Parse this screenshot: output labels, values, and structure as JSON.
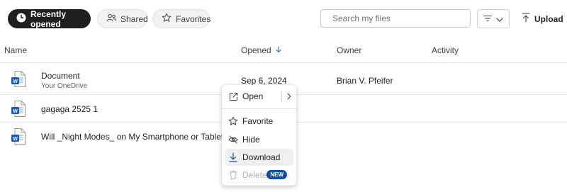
{
  "toolbar": {
    "pills": [
      {
        "label": "Recently opened",
        "icon": "clock-icon"
      },
      {
        "label": "Shared",
        "icon": "people-icon"
      },
      {
        "label": "Favorites",
        "icon": "star-icon"
      }
    ],
    "search_placeholder": "Search my files",
    "filter_icon": "filter-icon",
    "upload_label": "Upload"
  },
  "columns": {
    "name": "Name",
    "opened": "Opened",
    "owner": "Owner",
    "activity": "Activity"
  },
  "files": [
    {
      "name": "Document",
      "location": "Your OneDrive",
      "opened": "Sep 6, 2024",
      "owner": "Brian V. Pfeifer",
      "icon": "word-file-icon"
    },
    {
      "name": "gagaga 2525 1",
      "location": "",
      "opened": "",
      "owner": "",
      "icon": "word-file-icon"
    },
    {
      "name": "Will _Night Modes_ on My Smartphone or Tablet Actua",
      "location": "",
      "opened": "",
      "owner": "",
      "icon": "word-file-icon"
    }
  ],
  "context_menu": {
    "items": [
      {
        "label": "Open",
        "icon": "open-external-icon"
      },
      {
        "label": "Favorite",
        "icon": "star-icon"
      },
      {
        "label": "Hide",
        "icon": "eye-off-icon"
      },
      {
        "label": "Download",
        "icon": "download-icon"
      },
      {
        "label": "Delete",
        "icon": "trash-icon",
        "badge": "NEW",
        "disabled": true
      }
    ]
  },
  "colors": {
    "accent": "#1f1f1f",
    "word_blue": "#185abd",
    "badge_blue": "#0f4ea8",
    "link_blue": "#2a6cc9"
  }
}
